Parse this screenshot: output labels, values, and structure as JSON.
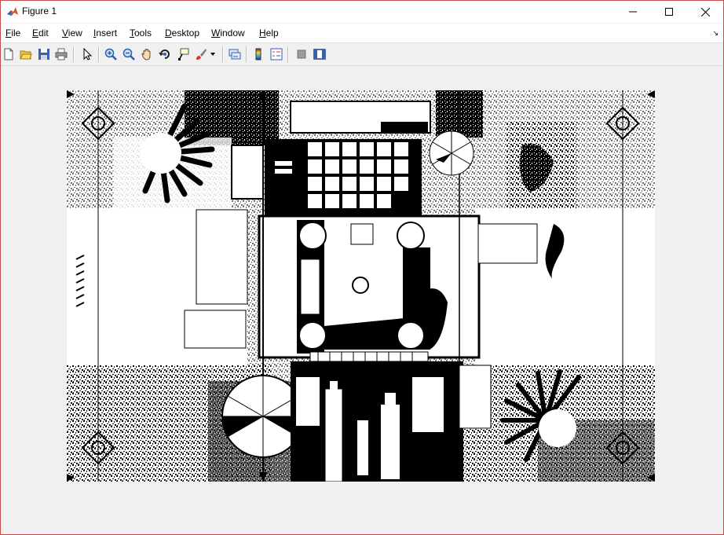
{
  "window": {
    "title": "Figure 1",
    "icon": "matlab-icon",
    "controls": [
      "minimize-icon",
      "maximize-icon",
      "close-icon"
    ]
  },
  "menu": {
    "items": [
      {
        "label": "File",
        "accel": "F",
        "rest": "ile"
      },
      {
        "label": "Edit",
        "accel": "E",
        "rest": "dit"
      },
      {
        "label": "View",
        "accel": "V",
        "rest": "iew"
      },
      {
        "label": "Insert",
        "accel": "I",
        "rest": "nsert"
      },
      {
        "label": "Tools",
        "accel": "T",
        "rest": "ools"
      },
      {
        "label": "Desktop",
        "accel": "D",
        "rest": "esktop"
      },
      {
        "label": "Window",
        "accel": "W",
        "rest": "indow"
      },
      {
        "label": "Help",
        "accel": "H",
        "rest": "elp"
      }
    ]
  },
  "toolbar": {
    "icons": [
      "new-figure-icon",
      "open-file-icon",
      "save-icon",
      "print-icon",
      "edit-plot-icon",
      "zoom-in-icon",
      "zoom-out-icon",
      "pan-icon",
      "rotate-3d-icon",
      "data-cursor-icon",
      "brush-icon",
      "link-plot-icon",
      "colorbar-icon",
      "legend-icon",
      "hide-plot-tools-icon",
      "show-plot-tools-icon"
    ]
  },
  "figure": {
    "content": "binary-test-chart-image",
    "colors": {
      "foreground": "#000000",
      "background": "#ffffff",
      "window_border": "#c64a4a"
    }
  }
}
